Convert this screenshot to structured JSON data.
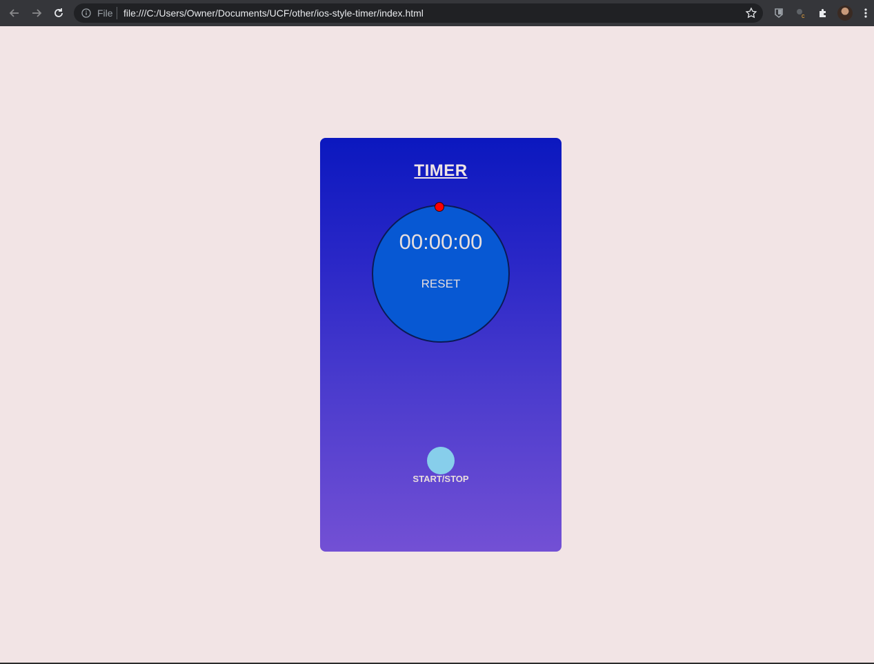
{
  "browser": {
    "scheme_label": "File",
    "url": "file:///C:/Users/Owner/Documents/UCF/other/ios-style-timer/index.html",
    "icons": [
      "back-arrow-icon",
      "forward-arrow-icon",
      "reload-icon",
      "info-icon",
      "star-icon",
      "extension-icon",
      "puzzle-icon",
      "menu-icon"
    ]
  },
  "app": {
    "title": "TIMER",
    "time": "00:00:00",
    "reset_label": "RESET",
    "start_stop_label": "START/STOP"
  },
  "colors": {
    "page_background": "#f2e4e5",
    "card_gradient_top": "#0b18bf",
    "card_gradient_bottom": "#7350d4",
    "dial": "#0758d3",
    "knob": "#ff0000",
    "start_button": "#87ceeb"
  }
}
